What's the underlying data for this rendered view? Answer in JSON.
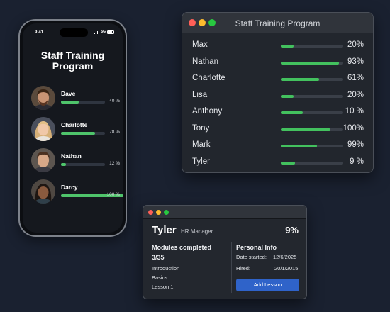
{
  "mobile": {
    "status": {
      "time": "9:41",
      "network": "5G"
    },
    "title_line1": "Staff Training",
    "title_line2": "Program",
    "members": [
      {
        "name": "Dave",
        "progress_label": "40 %",
        "progress": 0.4
      },
      {
        "name": "Charlotte",
        "progress_label": "78 %",
        "progress": 0.78
      },
      {
        "name": "Nathan",
        "progress_label": "12 %",
        "progress": 0.12
      },
      {
        "name": "Darcy",
        "progress_label": "100 %",
        "progress": 1.0
      }
    ]
  },
  "desktop": {
    "title": "Staff Training Program",
    "rows": [
      {
        "name": "Max",
        "progress_label": "20%",
        "progress": 0.2
      },
      {
        "name": "Nathan",
        "progress_label": "93%",
        "progress": 0.93
      },
      {
        "name": "Charlotte",
        "progress_label": "61%",
        "progress": 0.61
      },
      {
        "name": "Lisa",
        "progress_label": "20%",
        "progress": 0.2
      },
      {
        "name": "Anthony",
        "progress_label": "10 %",
        "progress": 0.35
      },
      {
        "name": "Tony",
        "progress_label": "100%",
        "progress": 0.8
      },
      {
        "name": "Mark",
        "progress_label": "99%",
        "progress": 0.58
      },
      {
        "name": "Tyler",
        "progress_label": "9 %",
        "progress": 0.23
      }
    ]
  },
  "detail": {
    "name": "Tyler",
    "role": "HR Manager",
    "progress_label": "9%",
    "modules_heading": "Modules completed",
    "modules_count": "3/35",
    "modules": [
      "Introduction",
      "Basics",
      "Lesson 1"
    ],
    "personal_heading": "Personal Info",
    "date_started_label": "Date started:",
    "date_started": "12/6/2025",
    "hired_label": "Hired:",
    "hired": "20/1/2015",
    "add_lesson_label": "Add Lesson"
  },
  "colors": {
    "background": "#1a2130",
    "progress_green": "#43c15e",
    "button_blue": "#2f63c9"
  }
}
